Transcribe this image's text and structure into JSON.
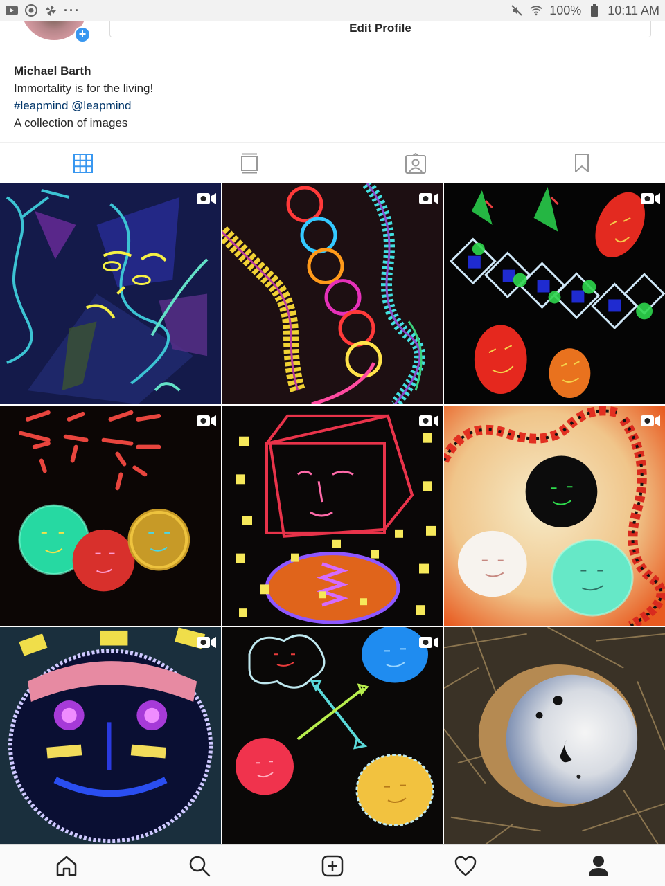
{
  "status_bar": {
    "left_icons": [
      "youtube-icon",
      "chrome-icon",
      "pinwheel-icon",
      "more-dots-icon"
    ],
    "mute_icon": "mute-icon",
    "wifi_icon": "wifi-icon",
    "battery_percent": "100%",
    "battery_icon": "battery-icon",
    "time": "10:11 AM"
  },
  "profile": {
    "edit_label": "Edit Profile",
    "name": "Michael Barth",
    "bio_line": "Immortality is for the living!",
    "tags": "#leapmind @leapmind",
    "description": "A collection of images"
  },
  "tabs": [
    {
      "name": "grid",
      "icon": "grid-icon",
      "active": true
    },
    {
      "name": "feed",
      "icon": "feed-icon",
      "active": false
    },
    {
      "name": "tagged",
      "icon": "tagged-icon",
      "active": false
    },
    {
      "name": "saved",
      "icon": "bookmark-icon",
      "active": false
    }
  ],
  "posts": [
    {
      "index": 1,
      "video": true
    },
    {
      "index": 2,
      "video": true
    },
    {
      "index": 3,
      "video": true
    },
    {
      "index": 4,
      "video": true
    },
    {
      "index": 5,
      "video": true
    },
    {
      "index": 6,
      "video": true
    },
    {
      "index": 7,
      "video": true
    },
    {
      "index": 8,
      "video": true
    },
    {
      "index": 9,
      "video": false
    }
  ],
  "bottom_nav": [
    "home-icon",
    "search-icon",
    "new-post-icon",
    "activity-icon",
    "profile-icon"
  ],
  "colors": {
    "accent_blue": "#3897f0",
    "link_blue": "#003569",
    "active_tab": "#3897f0",
    "inactive_tab": "#999999"
  }
}
